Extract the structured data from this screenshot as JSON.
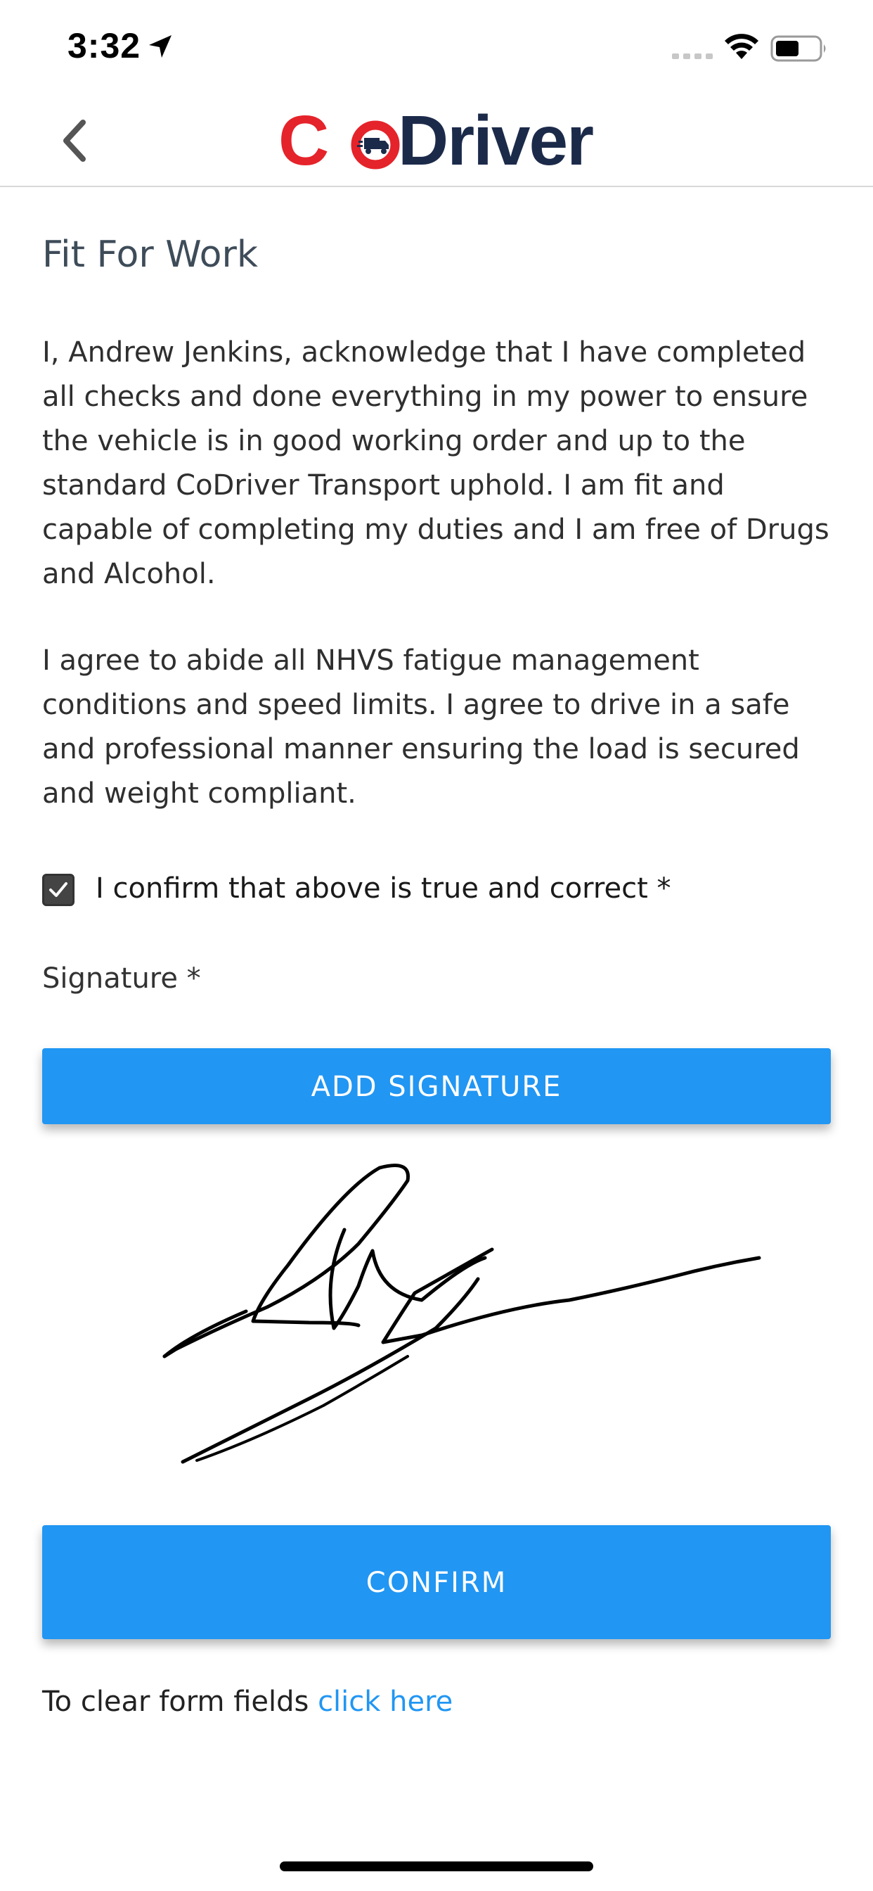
{
  "status_bar": {
    "time": "3:32"
  },
  "brand": {
    "logo_c": "C",
    "logo_driver": "Driver",
    "colors": {
      "red": "#e5232a",
      "navy": "#1c2a4a"
    }
  },
  "form": {
    "title": "Fit For Work",
    "paragraph_1": "I, Andrew Jenkins, acknowledge that I have completed all checks and done everything in my power to ensure the vehicle is in good working order and up to the standard CoDriver Transport uphold. I am fit and capable of completing my duties and I am free of Drugs and Alcohol.",
    "paragraph_2": "I agree to abide all NHVS fatigue management conditions and speed limits. I agree to drive in a safe and professional manner ensuring the load is secured and weight compliant.",
    "confirm_checkbox": {
      "label": "I confirm that above is true and correct *",
      "checked": true
    },
    "signature_label": "Signature *",
    "add_signature_label": "ADD SIGNATURE",
    "confirm_label": "CONFIRM",
    "clear_text": "To clear form fields ",
    "clear_link": "click here"
  },
  "icons": {
    "back": "chevron-left-icon",
    "location": "location-arrow-icon",
    "signal": "cellular-signal-icon",
    "wifi": "wifi-icon",
    "battery": "battery-icon",
    "truck": "truck-icon"
  },
  "accent_color": "#2196f3"
}
